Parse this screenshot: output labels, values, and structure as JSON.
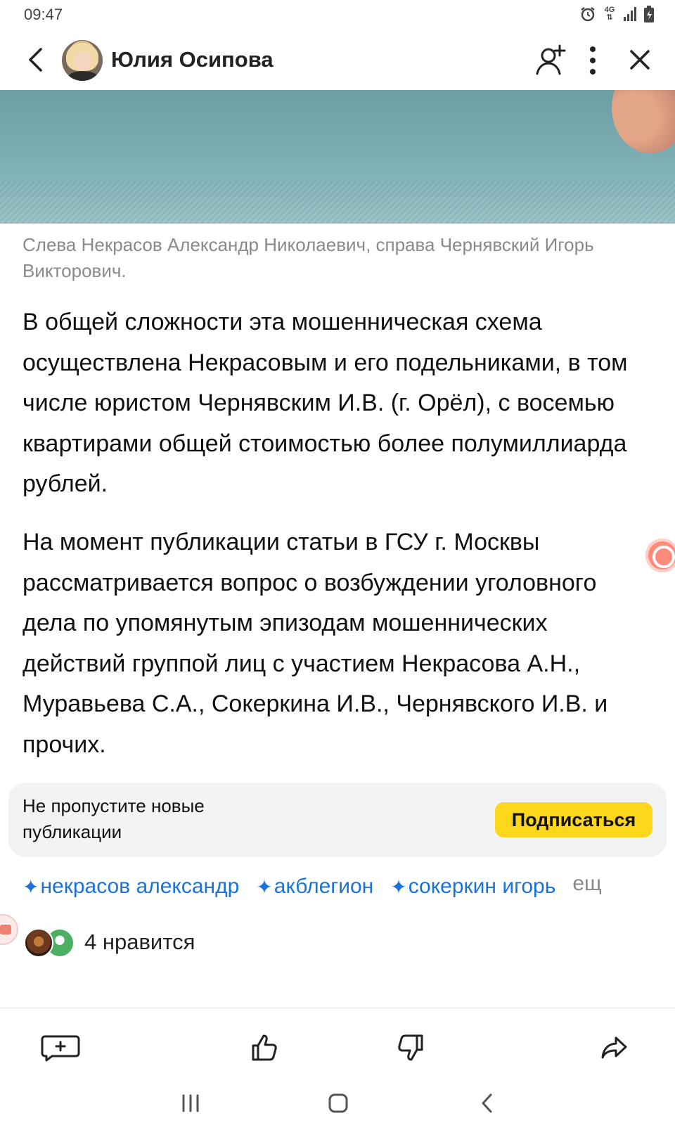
{
  "status_bar": {
    "time": "09:47",
    "network": "4G"
  },
  "header": {
    "author_name": "Юлия Осипова",
    "icons": [
      "back-arrow-icon",
      "add-user-icon",
      "more-vertical-icon",
      "close-icon"
    ]
  },
  "article": {
    "photo_caption": "Слева Некрасов Александр Николаевич, справа Чернявский Игорь Викторович.",
    "paragraphs": [
      "В общей сложности эта мошенническая схема осуществлена Некрасовым и его подельниками, в том числе юристом Чернявским И.В. (г. Орёл), с восемью квартирами общей стоимостью более полумиллиарда рублей.",
      "На момент публикации статьи в ГСУ г. Москвы рассматривается вопрос о возбуждении уголовного дела по упомянутым эпизодам мошеннических действий группой лиц с участием Некрасова А.Н., Муравьева С.А., Сокеркина И.В., Чернявского И.В. и прочих."
    ]
  },
  "subscribe": {
    "text": "Не пропустите новые публикации",
    "button_label": "Подписаться",
    "button_color": "#fcd71b"
  },
  "tags": {
    "items": [
      "некрасов александр",
      "акблегион",
      "сокеркин игорь"
    ],
    "more_label": "ещ",
    "color": "#1a73d9"
  },
  "likes": {
    "text": "4 нравится"
  },
  "action_bar": {
    "icons": [
      "add-comment-icon",
      "thumbs-up-icon",
      "thumbs-down-icon",
      "share-icon"
    ]
  },
  "nav_bar": {
    "icons": [
      "recent-apps-icon",
      "home-icon",
      "back-icon"
    ]
  }
}
